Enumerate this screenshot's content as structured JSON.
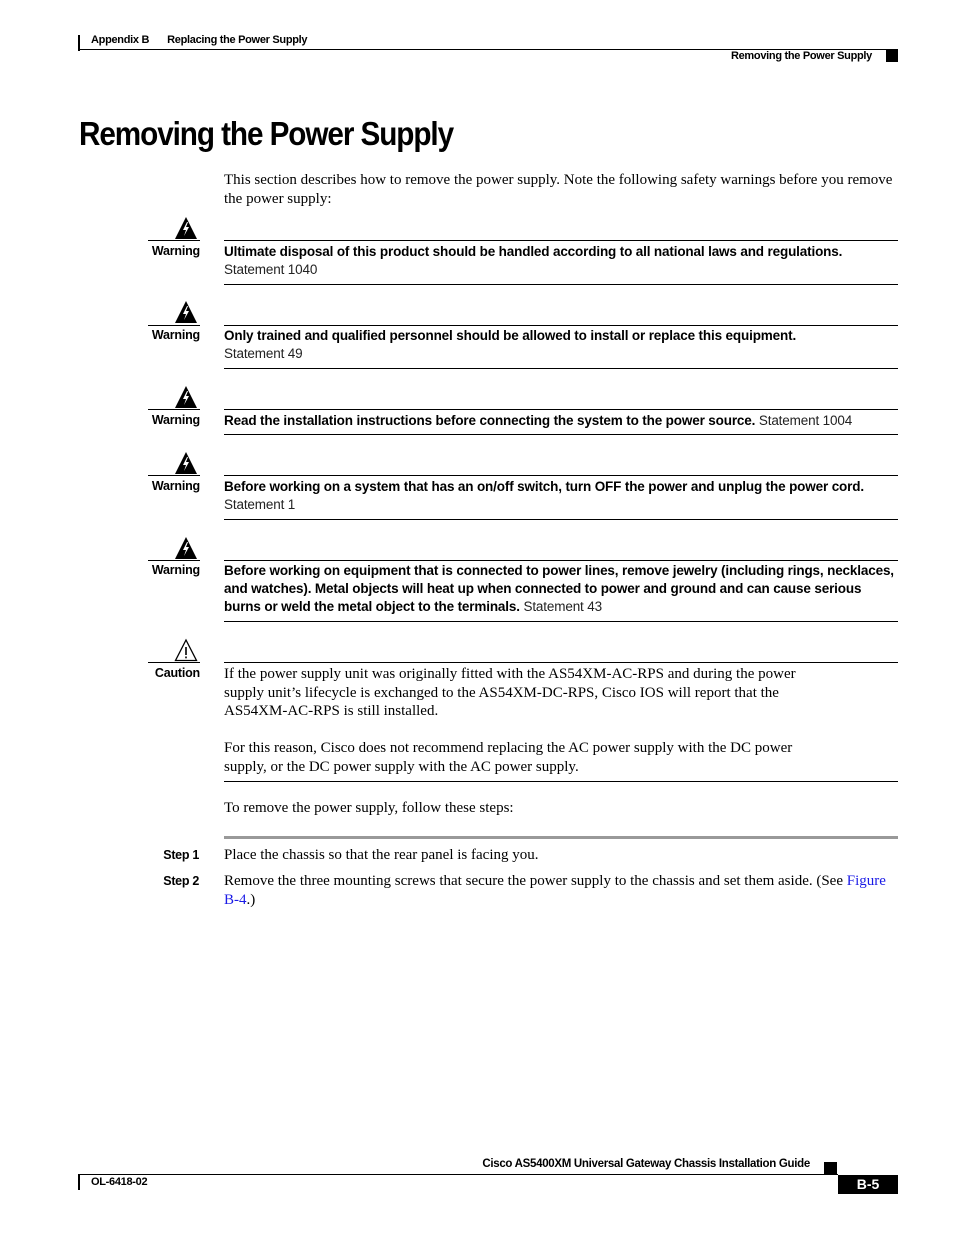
{
  "header": {
    "appendix": "Appendix B",
    "chapter": "Replacing the Power Supply",
    "section": "Removing the Power Supply"
  },
  "title": "Removing the Power Supply",
  "intro": "This section describes how to remove the power supply. Note the following safety warnings before you remove the power supply:",
  "warnings": [
    {
      "label": "Warning",
      "icon": "warning-shock-icon",
      "text": "Ultimate disposal of this product should be handled according to all national laws and regulations.",
      "statement": "Statement 1040"
    },
    {
      "label": "Warning",
      "icon": "warning-shock-icon",
      "text": "Only trained and qualified personnel should be allowed to install or replace this equipment.",
      "statement": "Statement 49"
    },
    {
      "label": "Warning",
      "icon": "warning-shock-icon",
      "text": "Read the installation instructions before connecting the system to the power source.",
      "statement": "Statement 1004"
    },
    {
      "label": "Warning",
      "icon": "warning-shock-icon",
      "text": "Before working on a system that has an on/off switch, turn OFF the power and unplug the power cord.",
      "statement": "Statement 1"
    },
    {
      "label": "Warning",
      "icon": "warning-shock-icon",
      "text": "Before working on equipment that is connected to power lines, remove jewelry (including rings, necklaces, and watches). Metal objects will heat up when connected to power and ground and can cause serious burns or weld the metal object to the terminals.",
      "statement": "Statement 43"
    }
  ],
  "caution": {
    "label": "Caution",
    "icon": "caution-exclamation-icon",
    "paragraph1": "If the power supply unit was originally fitted with the AS54XM-AC-RPS and during the power supply unit’s lifecycle is exchanged to the AS54XM-DC-RPS, Cisco IOS will report that the AS54XM-AC-RPS is still installed.",
    "paragraph2": "For this reason, Cisco does not recommend replacing the AC power supply with the DC power supply, or the DC power supply with the AC power supply."
  },
  "steps_intro": "To remove the power supply, follow these steps:",
  "steps": [
    {
      "label": "Step 1",
      "text": "Place the chassis so that the rear panel is facing you."
    },
    {
      "label": "Step 2",
      "text": "Remove the three mounting screws that secure the power supply to the chassis and set them aside. (See ",
      "link": "Figure B-4",
      "text_after": ".)"
    }
  ],
  "footer": {
    "guide_title": "Cisco AS5400XM Universal Gateway Chassis Installation Guide",
    "doc_number": "OL-6418-02",
    "page": "B-5"
  },
  "colors": {
    "link": "#1a1ae6",
    "rule_gray": "#999999"
  }
}
